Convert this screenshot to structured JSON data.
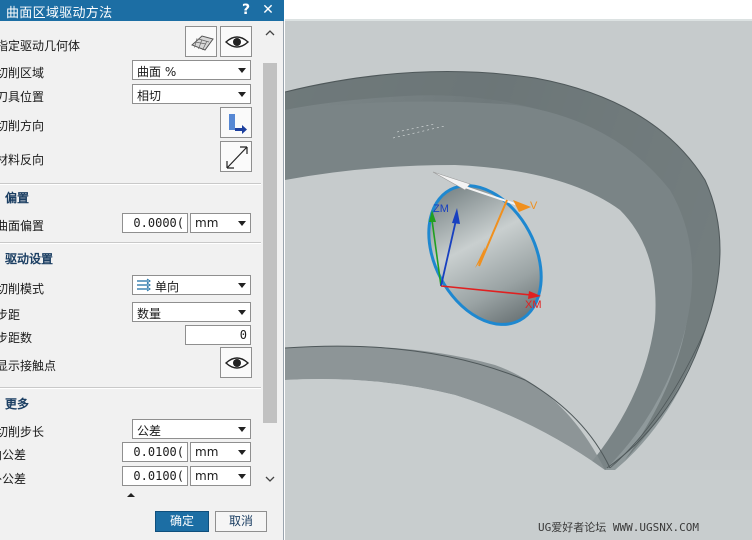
{
  "dialog": {
    "title": "曲面区域驱动方法",
    "help_label": "?",
    "close_label": "✕",
    "rows": {
      "drive_geometry": "指定驱动几何体",
      "cut_area": "切削区域",
      "tool_position": "刀具位置",
      "cut_direction": "切削方向",
      "material_reverse": "材料反向"
    },
    "cut_area_value": "曲面 %",
    "tool_position_value": "相切",
    "offset": {
      "header": "偏置",
      "surface_offset_label": "曲面偏置",
      "surface_offset_value": "0.0000(",
      "unit": "mm"
    },
    "drive_settings": {
      "header": "驱动设置",
      "cut_mode_label": "切削模式",
      "cut_mode_value": "单向",
      "stepover_label": "步距",
      "stepover_value": "数量",
      "stepover_count_label": "步距数",
      "stepover_count_value": "0",
      "show_contact_label": "显示接触点"
    },
    "more": {
      "header": "更多",
      "cut_step_label": "切削步长",
      "cut_step_value": "公差",
      "intol_label": "内公差",
      "intol_value": "0.0100(",
      "outtol_label": "外公差",
      "outtol_value": "0.0100(",
      "unit": "mm"
    },
    "ok_label": "确定",
    "cancel_label": "取消"
  },
  "viewport": {
    "axis_labels": {
      "zm": "ZM",
      "xm": "XM",
      "v": "V"
    },
    "watermark": "UG爱好者论坛 WWW.UGSNX.COM"
  },
  "colors": {
    "title_bar": "#1c6ea4",
    "section_header": "#1c3f63",
    "surface_gray": "#8b9598",
    "boundary_cyan": "#1e88d0",
    "axis_red": "#e02020",
    "axis_green": "#20a020",
    "axis_blue": "#1840c0",
    "vector_orange": "#f0901e"
  }
}
